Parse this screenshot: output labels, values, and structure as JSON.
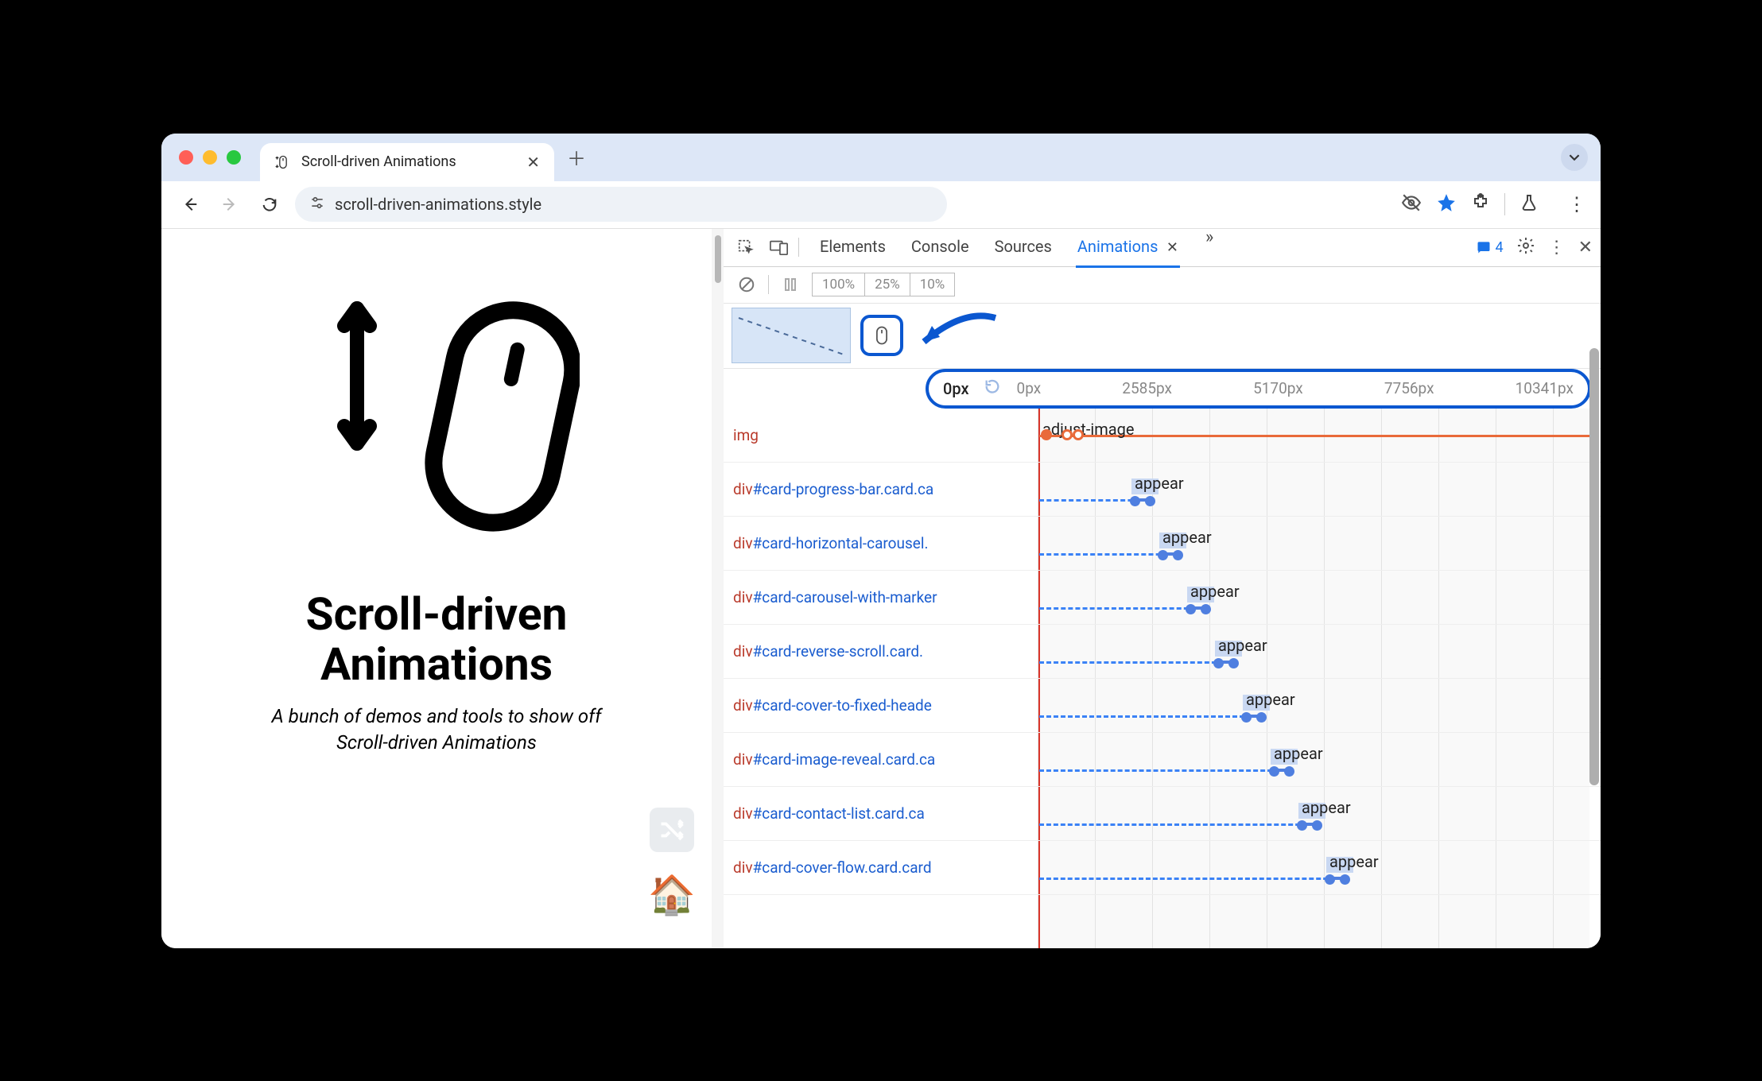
{
  "browser": {
    "tab_title": "Scroll-driven Animations",
    "url": "scroll-driven-animations.style"
  },
  "page": {
    "title_line1": "Scroll-driven",
    "title_line2": "Animations",
    "subtitle_line1": "A bunch of demos and tools to show off",
    "subtitle_line2": "Scroll-driven Animations"
  },
  "devtools": {
    "tabs": [
      "Elements",
      "Console",
      "Sources"
    ],
    "active_tab": "Animations",
    "issues_count": "4",
    "speeds": [
      "100%",
      "25%",
      "10%"
    ],
    "ruler": {
      "current": "0px",
      "ticks": [
        "0px",
        "2585px",
        "5170px",
        "7756px",
        "10341px"
      ]
    },
    "rows": [
      {
        "tag": "img",
        "id": "",
        "cls": "",
        "anim": "adjust-image",
        "offset": 2,
        "type": "first"
      },
      {
        "tag": "div",
        "id": "#card-progress-bar",
        "cls": ".card.ca",
        "anim": "appear",
        "offset": 120
      },
      {
        "tag": "div",
        "id": "#card-horizontal-carousel",
        "cls": ".",
        "anim": "appear",
        "offset": 155
      },
      {
        "tag": "div",
        "id": "#card-carousel-with-marker",
        "cls": "",
        "anim": "appear",
        "offset": 190
      },
      {
        "tag": "div",
        "id": "#card-reverse-scroll",
        "cls": ".card.",
        "anim": "appear",
        "offset": 225
      },
      {
        "tag": "div",
        "id": "#card-cover-to-fixed-heade",
        "cls": "",
        "anim": "appear",
        "offset": 260
      },
      {
        "tag": "div",
        "id": "#card-image-reveal",
        "cls": ".card.ca",
        "anim": "appear",
        "offset": 295
      },
      {
        "tag": "div",
        "id": "#card-contact-list",
        "cls": ".card.ca",
        "anim": "appear",
        "offset": 330
      },
      {
        "tag": "div",
        "id": "#card-cover-flow",
        "cls": ".card.card",
        "anim": "appear",
        "offset": 365
      }
    ]
  }
}
